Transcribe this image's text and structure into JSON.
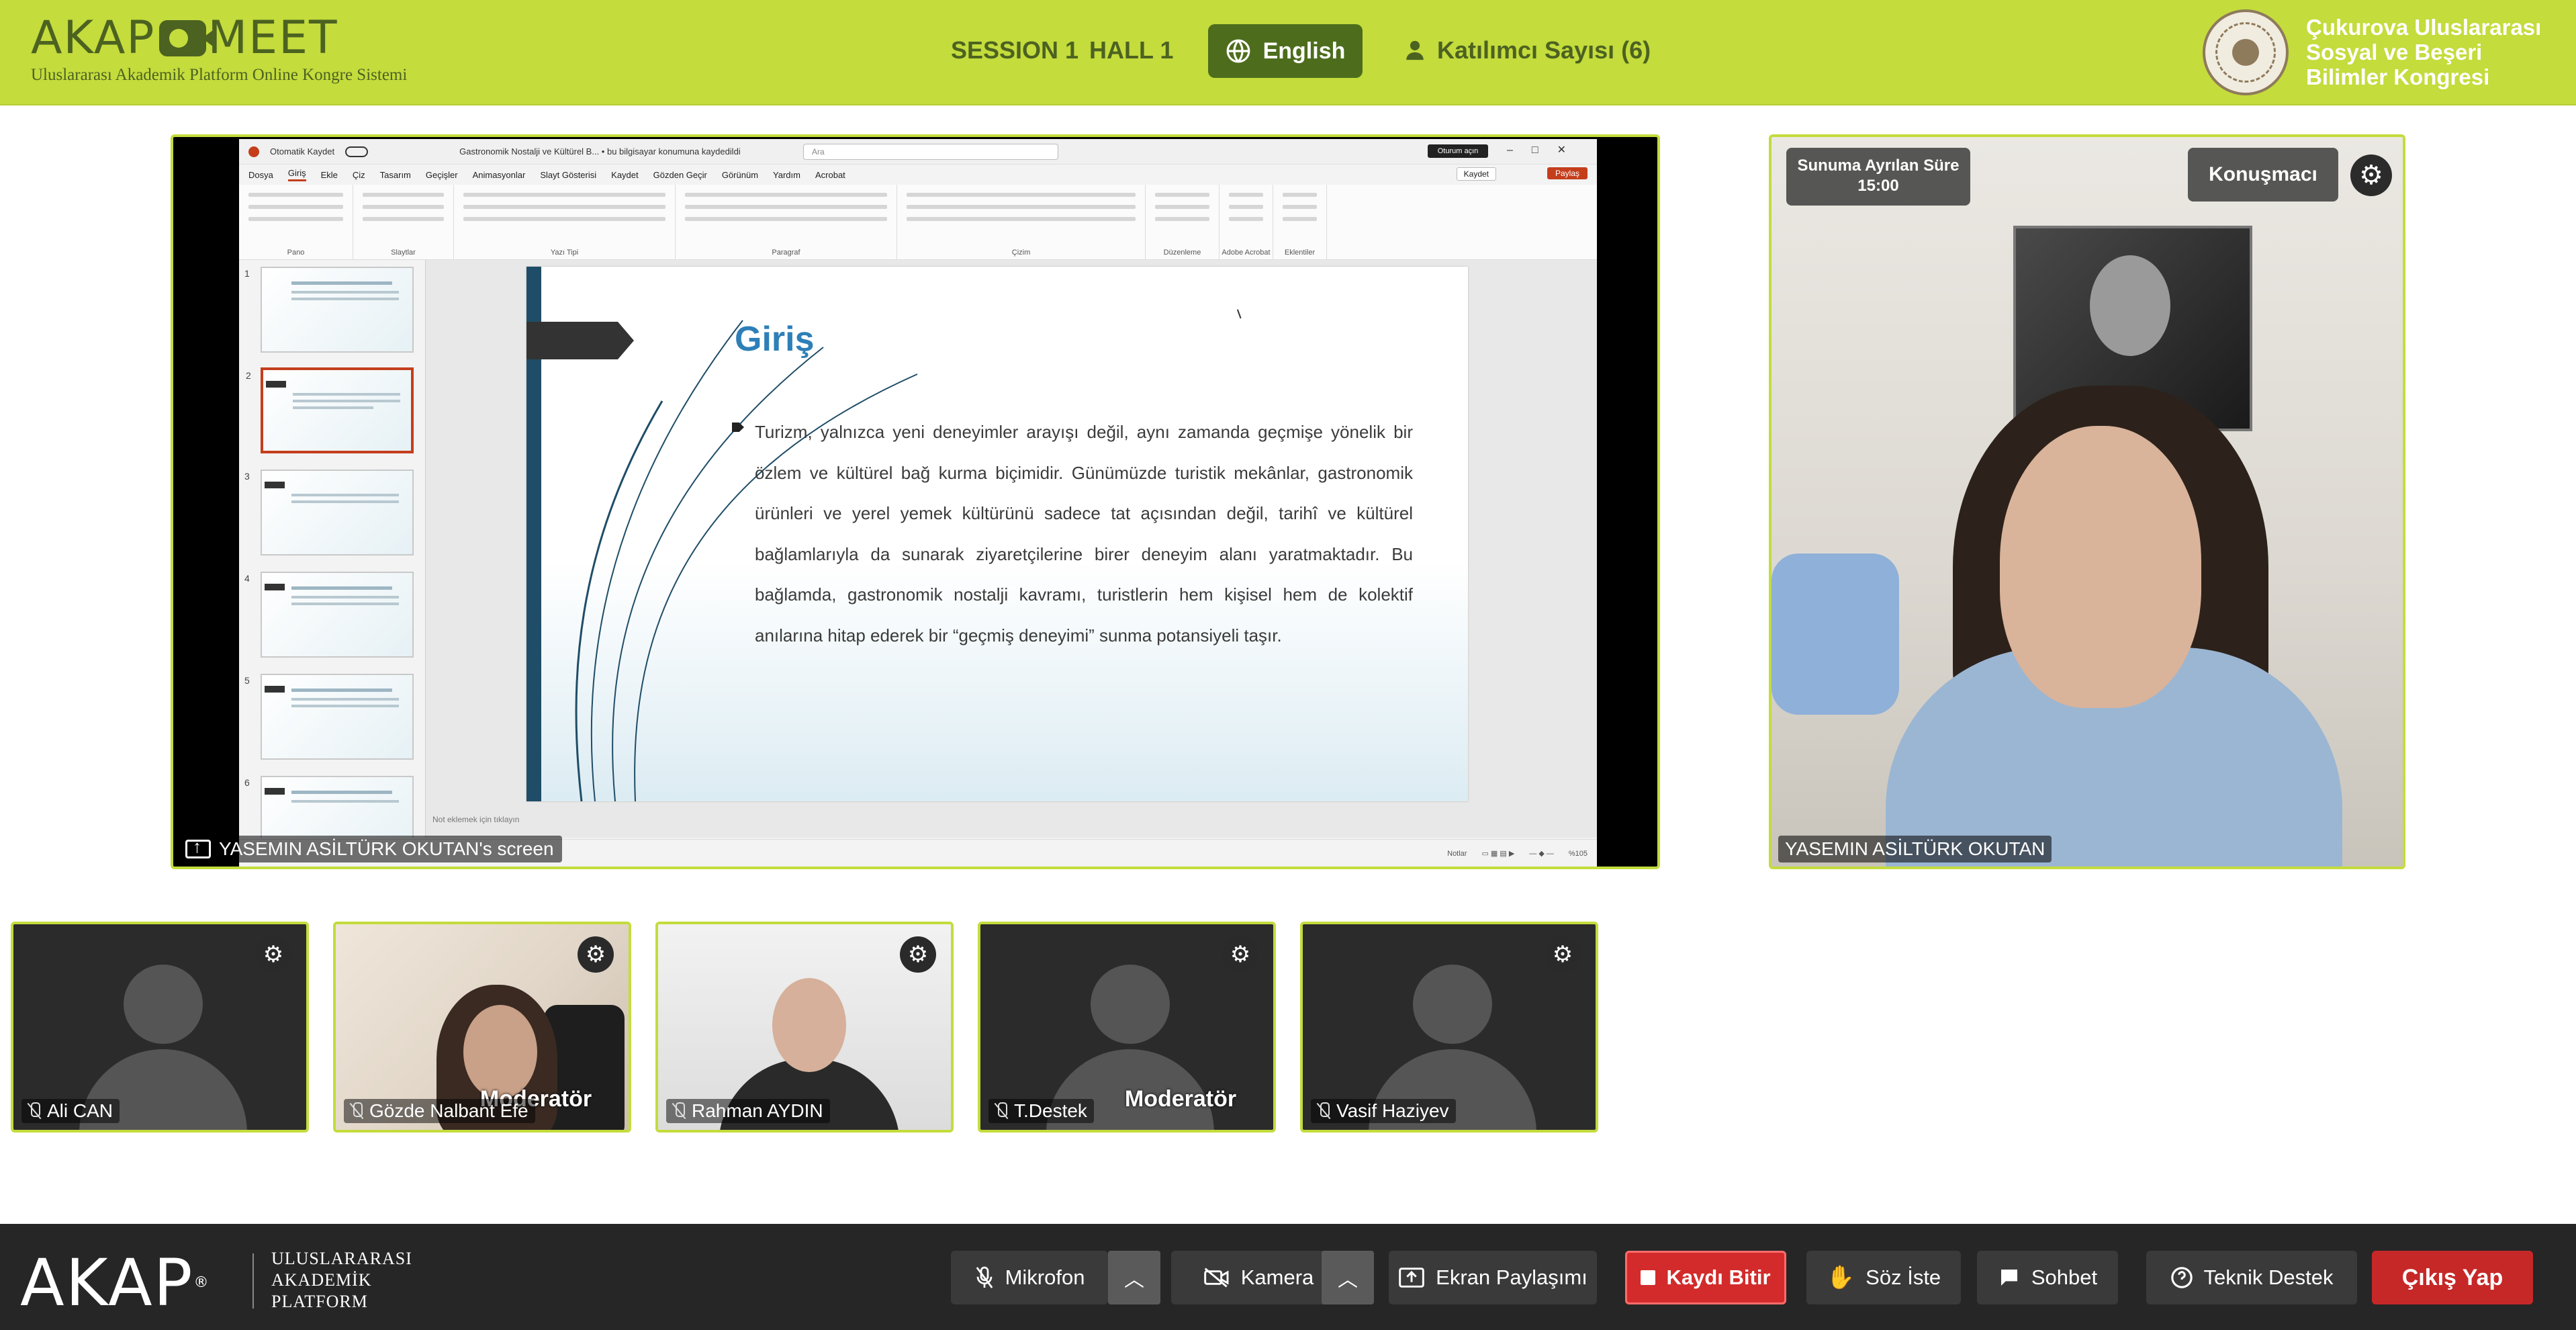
{
  "header": {
    "logo_text": "AKAP MEET",
    "logo_subtitle": "Uluslararası Akademik Platform Online Kongre Sistemi",
    "session": "SESSION 1",
    "hall": "HALL 1",
    "language_button": "English",
    "participants_label": "Katılımcı Sayısı (6)",
    "congress_name": [
      "Çukurova Uluslararası",
      "Sosyal ve Beşeri",
      "Bilimler Kongresi"
    ]
  },
  "shared_screen": {
    "owner_label": "YASEMIN ASİLTÜRK OKUTAN's screen",
    "powerpoint": {
      "autosave_label": "Otomatik Kaydet",
      "document_title": "Gastronomik Nostalji ve Kültürel B... • bu bilgisayar konumuna kaydedildi",
      "search_placeholder": "Ara",
      "sign_in": "Oturum açın",
      "menu": [
        "Dosya",
        "Giriş",
        "Ekle",
        "Çiz",
        "Tasarım",
        "Geçişler",
        "Animasyonlar",
        "Slayt Gösterisi",
        "Kaydet",
        "Gözden Geçir",
        "Görünüm",
        "Yardım",
        "Acrobat"
      ],
      "active_menu": "Giriş",
      "save_button": "Kaydet",
      "share_button": "Paylaş",
      "ribbon_groups": [
        "Pano",
        "Slaytlar",
        "Yazı Tipi",
        "Paragraf",
        "Çizim",
        "Düzenleme",
        "Adobe Acrobat",
        "Eklentiler"
      ],
      "thumbnails": [
        "1",
        "2",
        "3",
        "4",
        "5",
        "6"
      ],
      "selected_slide": 2,
      "notes_placeholder": "Not eklemek için tıklayın",
      "status_notes": "Notlar",
      "zoom": "%105"
    },
    "slide": {
      "title": "Giriş",
      "body": "Turizm, yalnızca yeni deneyimler arayışı değil, aynı zamanda geçmişe yönelik bir özlem ve kültürel bağ kurma biçimidir. Günümüzde turistik mekânlar, gastronomik ürünleri ve yerel yemek kültürünü sadece tat açısından değil, tarihî ve kültürel bağlamlarıyla da sunarak ziyaretçilerine birer deneyim alanı yaratmaktadır. Bu bağlamda, gastronomik nostalji kavramı, turistlerin hem kişisel hem de kolektif anılarına hitap ederek bir “geçmiş deneyimi” sunma potansiyeli taşır."
    }
  },
  "speaker": {
    "timer_label": "Sunuma Ayrılan Süre",
    "timer_value": "15:00",
    "role": "Konuşmacı",
    "name": "YASEMIN ASİLTÜRK OKUTAN"
  },
  "participants": [
    {
      "name": "Ali CAN",
      "badge": ""
    },
    {
      "name": "Gözde Nalbant Efe",
      "badge": "Moderatör"
    },
    {
      "name": "Rahman AYDIN",
      "badge": ""
    },
    {
      "name": "T.Destek",
      "badge": "Moderatör"
    },
    {
      "name": "Vasif Haziyev",
      "badge": ""
    }
  ],
  "toolbar": {
    "brand": "AKAP",
    "brand_subtitle": [
      "ULUSLARARASI",
      "AKADEMİK",
      "PLATFORM"
    ],
    "microphone": "Mikrofon",
    "camera": "Kamera",
    "screen_share": "Ekran Paylaşımı",
    "stop_recording": "Kaydı Bitir",
    "raise_hand": "Söz İste",
    "chat": "Sohbet",
    "support": "Teknik Destek",
    "exit": "Çıkış Yap"
  },
  "colors": {
    "header_bg": "#c4dc3c",
    "accent_dark": "#4c6221",
    "toolbar_bg": "#262626",
    "record_red": "#d32b2b",
    "exit_red": "#c62828"
  }
}
